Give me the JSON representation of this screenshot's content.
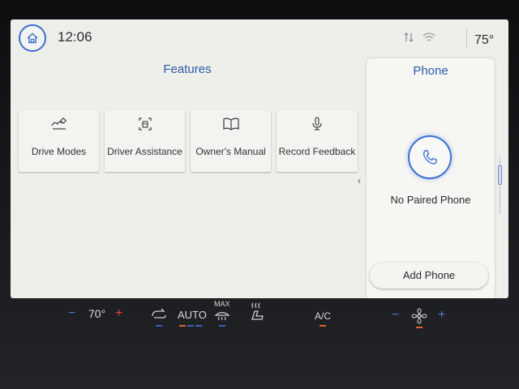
{
  "header": {
    "time": "12:06",
    "outside_temp": "75°",
    "icons": [
      "home-icon",
      "data-transfer-icon",
      "wifi-icon"
    ]
  },
  "features": {
    "title": "Features",
    "tiles": [
      {
        "label": "Drive Modes",
        "icon": "drive-modes-icon"
      },
      {
        "label": "Driver Assistance",
        "icon": "driver-assistance-icon"
      },
      {
        "label": "Owner's Manual",
        "icon": "book-icon"
      },
      {
        "label": "Record Feedback",
        "icon": "microphone-icon"
      }
    ]
  },
  "phone": {
    "title": "Phone",
    "status": "No Paired Phone",
    "add_label": "Add Phone"
  },
  "climate": {
    "driver_temp": "70°",
    "auto_label": "AUTO",
    "max_label": "MAX",
    "ac_label": "A/C"
  },
  "colors": {
    "accent": "#2c5aa8",
    "screen_bg": "#eeeeea",
    "indicator_orange": "#d9642a"
  }
}
